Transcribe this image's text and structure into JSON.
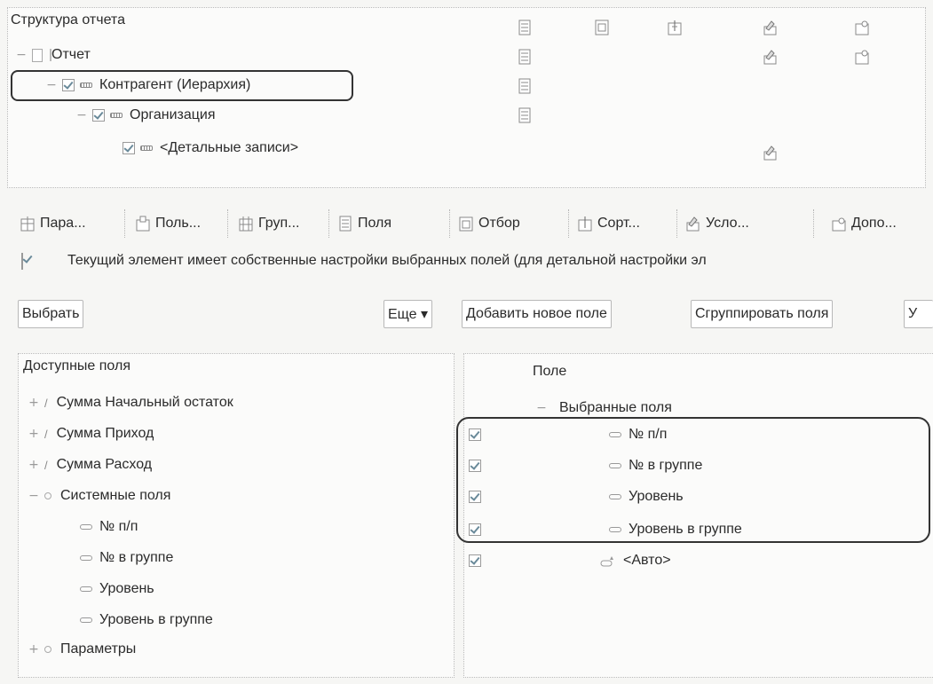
{
  "structure": {
    "title": "Структура отчета",
    "items": [
      {
        "label": "Отчет"
      },
      {
        "label": "Контрагент (Иерархия)"
      },
      {
        "label": "Организация"
      },
      {
        "label": "<Детальные записи>"
      }
    ]
  },
  "tabs": [
    {
      "label": "Пара..."
    },
    {
      "label": "Поль..."
    },
    {
      "label": "Груп..."
    },
    {
      "label": "Поля"
    },
    {
      "label": "Отбор"
    },
    {
      "label": "Сорт..."
    },
    {
      "label": "Усло..."
    },
    {
      "label": "Допо..."
    }
  ],
  "own_settings": {
    "checked": true,
    "text": "Текущий элемент имеет собственные настройки выбранных полей (для детальной настройки эл"
  },
  "toolbar": {
    "select": "Выбрать",
    "more": "Еще ▾",
    "add_field": "Добавить новое поле",
    "group_fields": "Сгруппировать поля",
    "truncated": "У"
  },
  "available": {
    "header": "Доступные поля",
    "items": [
      {
        "label": "Сумма Начальный остаток"
      },
      {
        "label": "Сумма Приход"
      },
      {
        "label": "Сумма Расход"
      },
      {
        "label": "Системные поля"
      },
      {
        "label": "№ п/п"
      },
      {
        "label": "№ в группе"
      },
      {
        "label": "Уровень"
      },
      {
        "label": "Уровень в группе"
      },
      {
        "label": "Параметры"
      }
    ]
  },
  "selected": {
    "header": "Поле",
    "group": "Выбранные поля",
    "items": [
      {
        "label": "№ п/п"
      },
      {
        "label": "№ в группе"
      },
      {
        "label": "Уровень"
      },
      {
        "label": "Уровень в группе"
      },
      {
        "label": "<Авто>"
      }
    ]
  },
  "icons": [
    "fields-icon",
    "selection-icon",
    "sort-icon",
    "conditional-format-icon",
    "extra-settings-icon",
    "parameters-icon",
    "user-fields-icon",
    "grouping-icon",
    "report-icon",
    "field-icon",
    "attribute-icon",
    "group-icon",
    "auto-icon"
  ]
}
